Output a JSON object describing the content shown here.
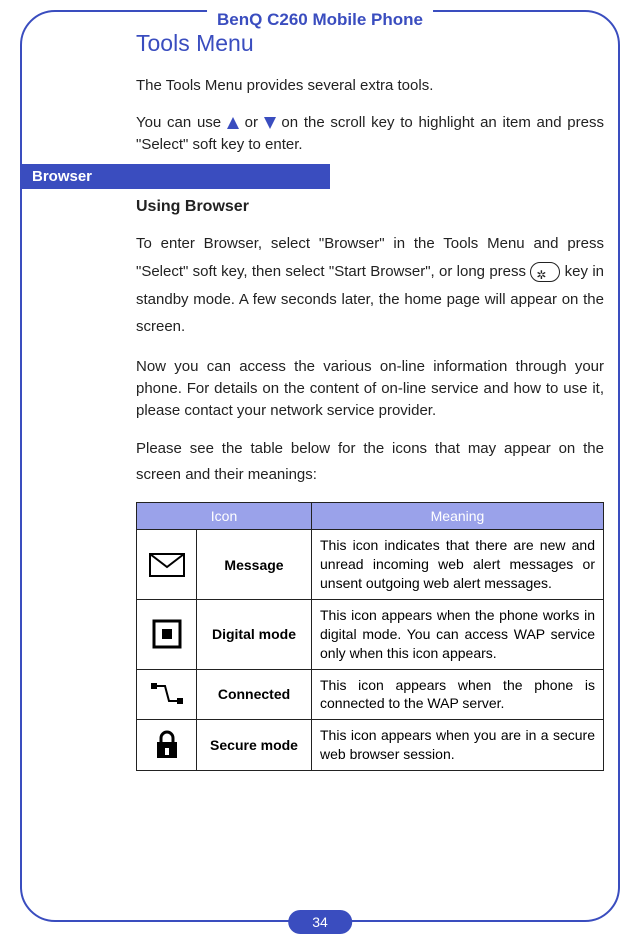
{
  "header": "BenQ C260 Mobile Phone",
  "pageNumber": "34",
  "title": "Tools Menu",
  "introText": "The Tools Menu provides several extra tools.",
  "scrollText1": "You can use ",
  "scrollText2": " or ",
  "scrollText3": " on the scroll key to highlight an item and press \"Select\" soft key to enter.",
  "section": {
    "label": "Browser",
    "subTitle": "Using Browser",
    "p1a": "To enter Browser, select \"Browser\" in the Tools Menu and press \"Select\" soft key, then select \"Start Browser\", or long press ",
    "p1b": " key in standby mode. A few seconds later, the home page will appear on the screen.",
    "p2": "Now you can access the various on-line information through your phone. For details on the content of on-line service and how to use it, please contact your network service provider.",
    "p3": "Please see the table below for the icons that may appear on the screen and their meanings:"
  },
  "table": {
    "headers": [
      "Icon",
      "Meaning"
    ],
    "rows": [
      {
        "name": "Message",
        "meaning": "This icon indicates that there are new and unread incoming web alert messages or unsent outgoing web alert messages."
      },
      {
        "name": "Digital mode",
        "meaning": "This icon appears when the phone works in digital mode. You can access WAP service only when this icon appears."
      },
      {
        "name": "Connected",
        "meaning": "This icon appears when the phone is connected to the WAP server."
      },
      {
        "name": "Secure mode",
        "meaning": "This icon appears when you are in a secure web browser session."
      }
    ]
  }
}
